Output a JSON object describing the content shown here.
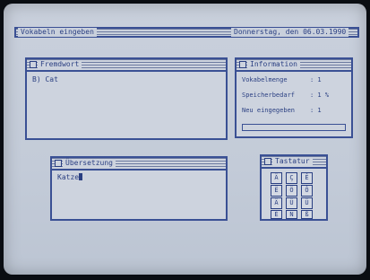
{
  "menubar": {
    "title": "Vokabeln eingeben",
    "date": "Donnerstag, den 06.03.1990"
  },
  "fremdwort": {
    "title": "Fremdwort",
    "value": "B) Cat"
  },
  "information": {
    "title": "Information",
    "lines": [
      {
        "label": "Vokabelmenge",
        "value": ": 1"
      },
      {
        "label": "Speicherbedarf",
        "value": ": 1 %"
      },
      {
        "label": "Neu eingegeben",
        "value": ": 1"
      }
    ]
  },
  "uebersetzung": {
    "title": "Übersetzung",
    "value": "Katze"
  },
  "tastatur": {
    "title": "Tastatur",
    "keys": [
      "Ä",
      "Ç",
      "Ê",
      "Ë",
      "Ö",
      "Ô",
      "Ä",
      "Ü",
      "Ü",
      "É",
      "Ñ",
      "ß"
    ]
  }
}
